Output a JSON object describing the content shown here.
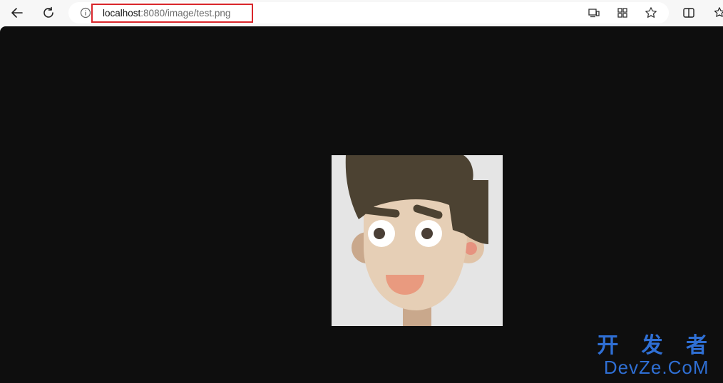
{
  "browser": {
    "address_bar": {
      "url_host": "localhost",
      "url_path": ":8080/image/test.png"
    },
    "icons": {
      "back": "arrow-left",
      "reload": "circular-arrow",
      "info": "info-circle",
      "cast": "device-cast",
      "apps": "app-grid",
      "favorite": "star-outline",
      "split": "split-screen",
      "favorites": "star-list"
    }
  },
  "image_viewer": {
    "background": "#0e0e0e",
    "image_bg": "#e5e5e5"
  },
  "watermark": {
    "line1": "开 发 者",
    "line2": "DevZe.CoM",
    "color": "#2f6fd4"
  }
}
